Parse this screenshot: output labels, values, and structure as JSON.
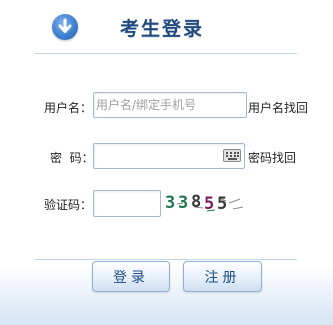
{
  "header": {
    "title": "考生登录"
  },
  "form": {
    "username": {
      "label": "用户名：",
      "placeholder": "用户名/绑定手机号",
      "value": "",
      "recover_link": "用户名找回"
    },
    "password": {
      "label": "密  码：",
      "value": "",
      "recover_link": "密码找回"
    },
    "captcha": {
      "label": "验证码：",
      "value": "",
      "image_text": "33855"
    }
  },
  "buttons": {
    "login": "登录",
    "register": "注册"
  },
  "colors": {
    "title": "#234a7c",
    "accent": "#3f7fd0",
    "button_text": "#1f4f86",
    "border": "#a8b8cc"
  }
}
